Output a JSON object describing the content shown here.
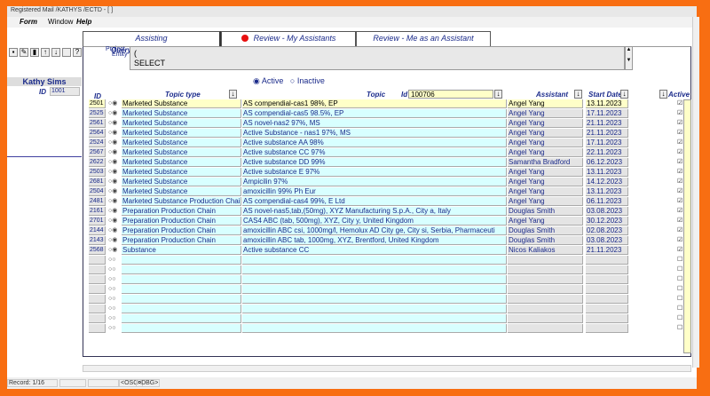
{
  "window": {
    "title": "Registered Mail /KATHYS /ECTD - [ ]"
  },
  "menu": [
    "Form",
    "Window",
    "Help"
  ],
  "toolbar": [
    "save-icon",
    "edit-icon",
    "exit-icon",
    "arrow-up-icon",
    "arrow-down-icon",
    "blank",
    "help-icon"
  ],
  "toolbar_glyphs": [
    "▪",
    "✎",
    "▮",
    "↑",
    "↓",
    "",
    "?"
  ],
  "user": {
    "name": "Kathy Sims",
    "id_label": "ID",
    "id": "1001"
  },
  "tabs": [
    {
      "label": "Assisting"
    },
    {
      "label": "Review - My Assistants",
      "active": true
    },
    {
      "label": "Review - Me as an Assistant"
    }
  ],
  "query": {
    "label": "Query:",
    "text": "(\nSELECT"
  },
  "vertical_labels": {
    "project": "Project",
    "entity": "Entity"
  },
  "filter": {
    "active": "Active",
    "inactive": "Inactive",
    "selected": "Active"
  },
  "headers": {
    "id": "ID",
    "topic_type": "Topic type",
    "topic": "Topic",
    "id_filter_label": "Id",
    "id_filter_value": "100706",
    "assistant": "Assistant",
    "start_date": "Start Date",
    "active": "Active"
  },
  "rows": [
    {
      "id": "2501",
      "type": "Marketed Substance",
      "topic": "AS compendial-cas1 98%, EP",
      "assistant": "Angel Yang",
      "date": "13.11.2023",
      "active": true
    },
    {
      "id": "2525",
      "type": "Marketed Substance",
      "topic": "AS compendial-cas5 98.5%, EP",
      "assistant": "Angel Yang",
      "date": "17.11.2023",
      "active": true
    },
    {
      "id": "2561",
      "type": "Marketed Substance",
      "topic": "AS novel-nas2 97%, MS",
      "assistant": "Angel Yang",
      "date": "21.11.2023",
      "active": true
    },
    {
      "id": "2564",
      "type": "Marketed Substance",
      "topic": "Active Substance - nas1 97%, MS",
      "assistant": "Angel Yang",
      "date": "21.11.2023",
      "active": true
    },
    {
      "id": "2524",
      "type": "Marketed Substance",
      "topic": "Active substance AA 98%",
      "assistant": "Angel Yang",
      "date": "17.11.2023",
      "active": true
    },
    {
      "id": "2567",
      "type": "Marketed Substance",
      "topic": "Active substance CC 97%",
      "assistant": "Angel Yang",
      "date": "22.11.2023",
      "active": true
    },
    {
      "id": "2622",
      "type": "Marketed Substance",
      "topic": "Active substance DD 99%",
      "assistant": "Samantha Bradford",
      "date": "06.12.2023",
      "active": true
    },
    {
      "id": "2503",
      "type": "Marketed Substance",
      "topic": "Active substance E 97%",
      "assistant": "Angel Yang",
      "date": "13.11.2023",
      "active": true
    },
    {
      "id": "2681",
      "type": "Marketed Substance",
      "topic": "Ampicilin 97%",
      "assistant": "Angel Yang",
      "date": "14.12.2023",
      "active": true
    },
    {
      "id": "2504",
      "type": "Marketed Substance",
      "topic": "amoxicillin 99% Ph Eur",
      "assistant": "Angel Yang",
      "date": "13.11.2023",
      "active": true
    },
    {
      "id": "2481",
      "type": "Marketed Substance Production Chain",
      "topic": "AS compendial-cas4 99%, E            Ltd",
      "assistant": "Angel Yang",
      "date": "06.11.2023",
      "active": true
    },
    {
      "id": "2161",
      "type": "Preparation Production Chain",
      "topic": "AS novel-nas5,tab,(50mg), XYZ Manufacturing S.p.A., City a, Italy",
      "assistant": "Douglas Smith",
      "date": "03.08.2023",
      "active": true
    },
    {
      "id": "2701",
      "type": "Preparation Production Chain",
      "topic": "CAS4 ABC (tab, 500mg), XYZ, City y, United Kingdom",
      "assistant": "Angel Yang",
      "date": "30.12.2023",
      "active": true
    },
    {
      "id": "2144",
      "type": "Preparation Production Chain",
      "topic": "amoxicillin ABC csi, 1000mg/l, Hemolux AD City ge, City si, Serbia, Pharmaceuti",
      "assistant": "Douglas Smith",
      "date": "02.08.2023",
      "active": true
    },
    {
      "id": "2143",
      "type": "Preparation Production Chain",
      "topic": "amoxicillin ABC tab, 1000mg, XYZ, Brentford, United Kingdom",
      "assistant": "Douglas Smith",
      "date": "03.08.2023",
      "active": true
    },
    {
      "id": "2568",
      "type": "Substance",
      "topic": "Active substance CC",
      "assistant": "Nicos Kaliakos",
      "date": "21.11.2023",
      "active": true
    }
  ],
  "empty_rows": 8,
  "status": {
    "record": "Record: 1/16",
    "osc": "<OSC>",
    "dbg": "<DBG>"
  }
}
